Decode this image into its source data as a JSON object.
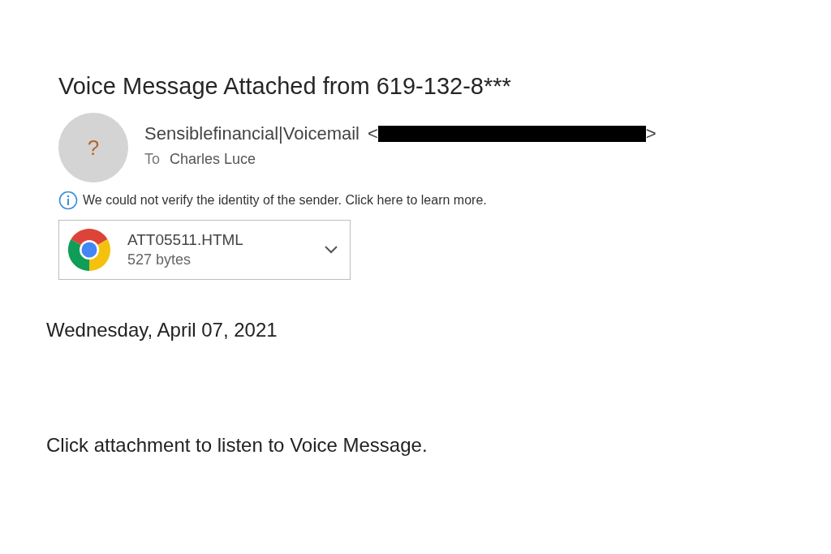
{
  "subject": "Voice Message Attached from 619-132-8***",
  "sender": {
    "avatar": "?",
    "name": "Sensiblefinancial|Voicemail",
    "open_bracket": "<",
    "close_bracket": ">",
    "redacted": true
  },
  "recipient": {
    "label": "To",
    "name": "Charles Luce"
  },
  "info_bar": {
    "text": "We could not verify the identity of the sender. Click here to learn more."
  },
  "attachment": {
    "name": "ATT05511.HTML",
    "size": "527 bytes"
  },
  "body": [
    {
      "text": "Wednesday, April 07, 2021"
    },
    {
      "text": "Click attachment to listen to Voice Message."
    }
  ]
}
